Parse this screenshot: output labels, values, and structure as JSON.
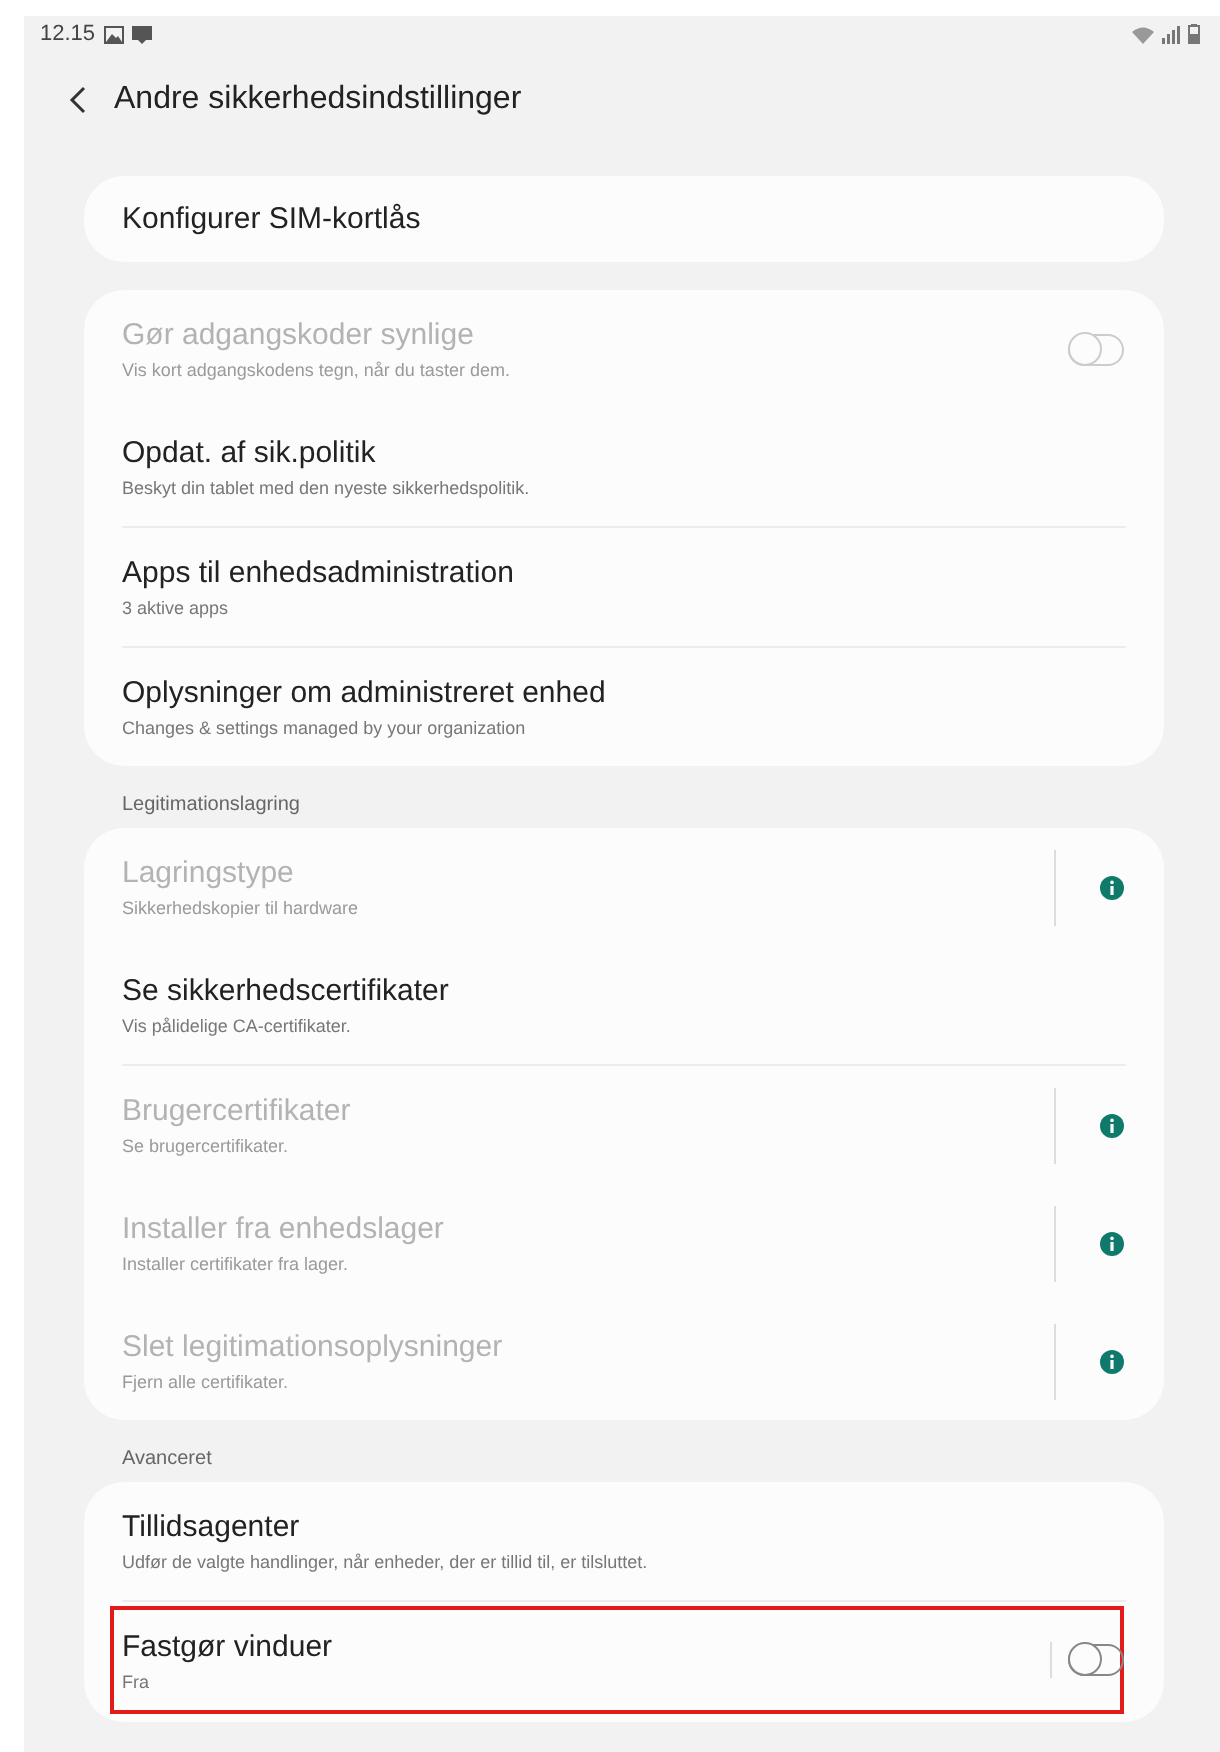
{
  "status_bar": {
    "time": "12.15"
  },
  "header": {
    "title": "Andre sikkerhedsindstillinger"
  },
  "sections": [
    {
      "items": [
        {
          "kind": "plain",
          "title": "Konfigurer SIM-kortlås",
          "disabled": false,
          "highlighted": false
        }
      ]
    },
    {
      "items": [
        {
          "kind": "toggle",
          "title": "Gør adgangskoder synlige",
          "subtitle": "Vis kort adgangskodens tegn, når du taster dem.",
          "disabled": true,
          "on": false,
          "highlighted": false
        },
        {
          "kind": "plain",
          "title": "Opdat. af sik.politik",
          "subtitle": "Beskyt din tablet med den nyeste sikkerhedspolitik.",
          "disabled": false,
          "highlighted": false
        },
        {
          "kind": "plain",
          "title": "Apps til enhedsadministration",
          "subtitle": "3 aktive apps",
          "disabled": false,
          "highlighted": false
        },
        {
          "kind": "plain",
          "title": "Oplysninger om administreret enhed",
          "subtitle": "Changes & settings managed by your organization",
          "disabled": false,
          "highlighted": false
        }
      ]
    },
    {
      "label": "Legitimationslagring",
      "items": [
        {
          "kind": "info",
          "title": "Lagringstype",
          "subtitle": "Sikkerhedskopier til hardware",
          "disabled": true,
          "highlighted": false
        },
        {
          "kind": "plain",
          "title": "Se sikkerhedscertifikater",
          "subtitle": "Vis pålidelige CA-certifikater.",
          "disabled": false,
          "highlighted": false
        },
        {
          "kind": "info",
          "title": "Brugercertifikater",
          "subtitle": "Se brugercertifikater.",
          "disabled": true,
          "highlighted": false
        },
        {
          "kind": "info",
          "title": "Installer fra enhedslager",
          "subtitle": "Installer certifikater fra lager.",
          "disabled": true,
          "highlighted": false
        },
        {
          "kind": "info",
          "title": "Slet legitimationsoplysninger",
          "subtitle": "Fjern alle certifikater.",
          "disabled": true,
          "highlighted": false
        }
      ]
    },
    {
      "label": "Avanceret",
      "items": [
        {
          "kind": "plain",
          "title": "Tillidsagenter",
          "subtitle": "Udfør de valgte handlinger, når enheder, der er tillid til, er tilsluttet.",
          "disabled": false,
          "highlighted": false
        },
        {
          "kind": "toggle",
          "title": "Fastgør vinduer",
          "subtitle": "Fra",
          "disabled": false,
          "on": false,
          "highlighted": true
        }
      ]
    }
  ]
}
